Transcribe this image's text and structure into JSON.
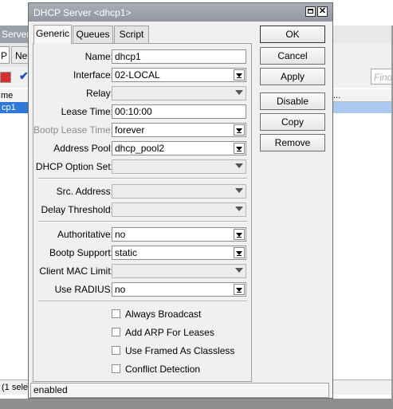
{
  "background": {
    "window_title": "Server",
    "tab1": "P",
    "tab2": "Net",
    "find_placeholder": "Find",
    "col_header": "me",
    "col_header_right": "...",
    "row_name": "cp1",
    "status_text": "(1 selec"
  },
  "dialog": {
    "title": "DHCP Server <dhcp1>",
    "tabs": [
      "Generic",
      "Queues",
      "Script"
    ],
    "fields": {
      "name": {
        "label": "Name:",
        "value": "dhcp1"
      },
      "interface": {
        "label": "Interface:",
        "value": "02-LOCAL"
      },
      "relay": {
        "label": "Relay:",
        "value": ""
      },
      "lease_time": {
        "label": "Lease Time:",
        "value": "00:10:00"
      },
      "bootp_lease_time": {
        "label": "Bootp Lease Time:",
        "value": "forever"
      },
      "address_pool": {
        "label": "Address Pool:",
        "value": "dhcp_pool2"
      },
      "dhcp_option_set": {
        "label": "DHCP Option Set:",
        "value": ""
      },
      "src_address": {
        "label": "Src. Address:",
        "value": ""
      },
      "delay_threshold": {
        "label": "Delay Threshold:",
        "value": ""
      },
      "authoritative": {
        "label": "Authoritative:",
        "value": "no"
      },
      "bootp_support": {
        "label": "Bootp Support:",
        "value": "static"
      },
      "client_mac_limit": {
        "label": "Client MAC Limit:",
        "value": ""
      },
      "use_radius": {
        "label": "Use RADIUS:",
        "value": "no"
      }
    },
    "checkboxes": {
      "always_broadcast": {
        "label": "Always Broadcast",
        "checked": false
      },
      "add_arp": {
        "label": "Add ARP For Leases",
        "checked": false
      },
      "use_framed": {
        "label": "Use Framed As Classless",
        "checked": false
      },
      "conflict_detection": {
        "label": "Conflict Detection",
        "checked": false
      }
    },
    "buttons": {
      "ok": "OK",
      "cancel": "Cancel",
      "apply": "Apply",
      "disable": "Disable",
      "copy": "Copy",
      "remove": "Remove"
    },
    "status": "enabled"
  }
}
